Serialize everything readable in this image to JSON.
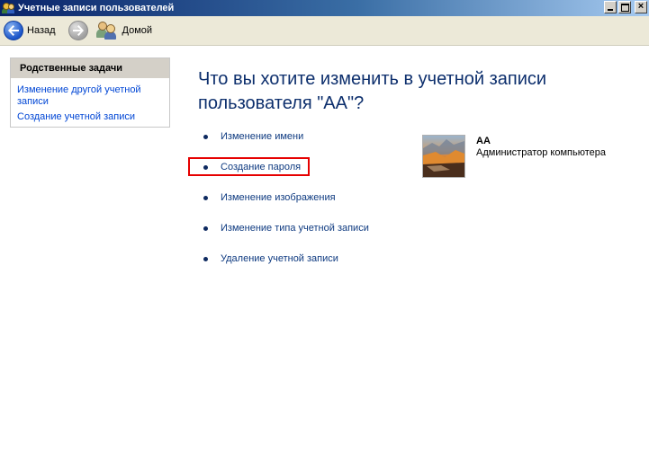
{
  "window": {
    "title": "Учетные записи пользователей",
    "buttons": [
      "minimize",
      "maximize",
      "close"
    ]
  },
  "toolbar": {
    "back_label": "Назад",
    "home_label": "Домой"
  },
  "sidebar": {
    "header": "Родственные задачи",
    "links": [
      "Изменение другой учетной записи",
      "Создание учетной записи"
    ]
  },
  "main": {
    "heading": "Что вы хотите изменить в учетной записи пользователя \"АА\"?",
    "tasks": [
      "Изменение имени",
      "Создание пароля",
      "Изменение изображения",
      "Изменение типа учетной записи",
      "Удаление учетной записи"
    ],
    "highlighted_task": "Создание пароля",
    "highlight_color": "#e60000"
  },
  "user": {
    "name": "АА",
    "role": "Администратор компьютера"
  },
  "colors": {
    "heading": "#0d2f6d",
    "link": "#0046d5",
    "task": "#0e3a80",
    "toolbar_bg": "#ece9d8"
  },
  "icons": [
    "users-icon",
    "back-arrow-icon",
    "forward-arrow-icon",
    "home-users-icon",
    "user-picture"
  ]
}
